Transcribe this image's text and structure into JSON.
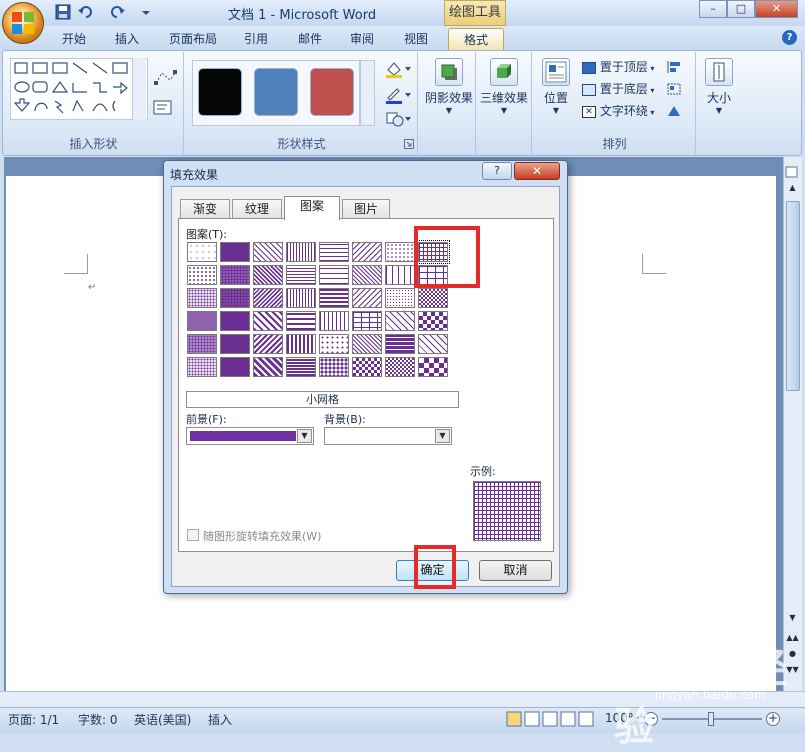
{
  "window": {
    "title": "文档 1 - Microsoft Word",
    "contextual_tab_header": "绘图工具",
    "controls": {
      "minimize": "–",
      "maximize": "□",
      "close": "✕"
    }
  },
  "ribbon": {
    "tabs": [
      {
        "label": "开始"
      },
      {
        "label": "插入"
      },
      {
        "label": "页面布局"
      },
      {
        "label": "引用"
      },
      {
        "label": "邮件"
      },
      {
        "label": "审阅"
      },
      {
        "label": "视图"
      },
      {
        "label": "格式",
        "active": true
      }
    ],
    "groups": {
      "insert_shapes": {
        "label": "插入形状"
      },
      "shape_styles": {
        "label": "形状样式",
        "swatches": [
          "#060606",
          "#4f81bd",
          "#c0504d"
        ]
      },
      "shadow_effects": {
        "label": "阴影效果"
      },
      "three_d_effects": {
        "label": "三维效果"
      },
      "arrange": {
        "label": "排列",
        "position_label": "位置",
        "bring_to_front": "置于顶层",
        "send_to_back": "置于底层",
        "text_wrapping": "文字环绕"
      },
      "size": {
        "label": "大小"
      }
    }
  },
  "dialog": {
    "title": "填充效果",
    "help": "?",
    "close": "✕",
    "tabs": [
      {
        "label": "渐变"
      },
      {
        "label": "纹理"
      },
      {
        "label": "图案",
        "active": true
      },
      {
        "label": "图片"
      }
    ],
    "pattern_label": "图案(T):",
    "selected_pattern_name": "小网格",
    "selected_pattern_index": 7,
    "foreground_label": "前景(F):",
    "foreground_color": "#7030a0",
    "background_label": "背景(B):",
    "background_color": "#ffffff",
    "sample_label": "示例:",
    "rotate_checkbox_label": "随图形旋转填充效果(W)",
    "rotate_checked": false,
    "ok_label": "确定",
    "cancel_label": "取消"
  },
  "statusbar": {
    "page": "页面: 1/1",
    "words": "字数: 0",
    "language": "英语(美国)",
    "mode": "插入",
    "zoom": "100%"
  },
  "watermark": {
    "text": "Baidu经验",
    "url": "jingyan.baidu.com"
  },
  "colors": {
    "accent_highlight": "#e52a2a",
    "pattern_fill": "#6b2f93"
  }
}
